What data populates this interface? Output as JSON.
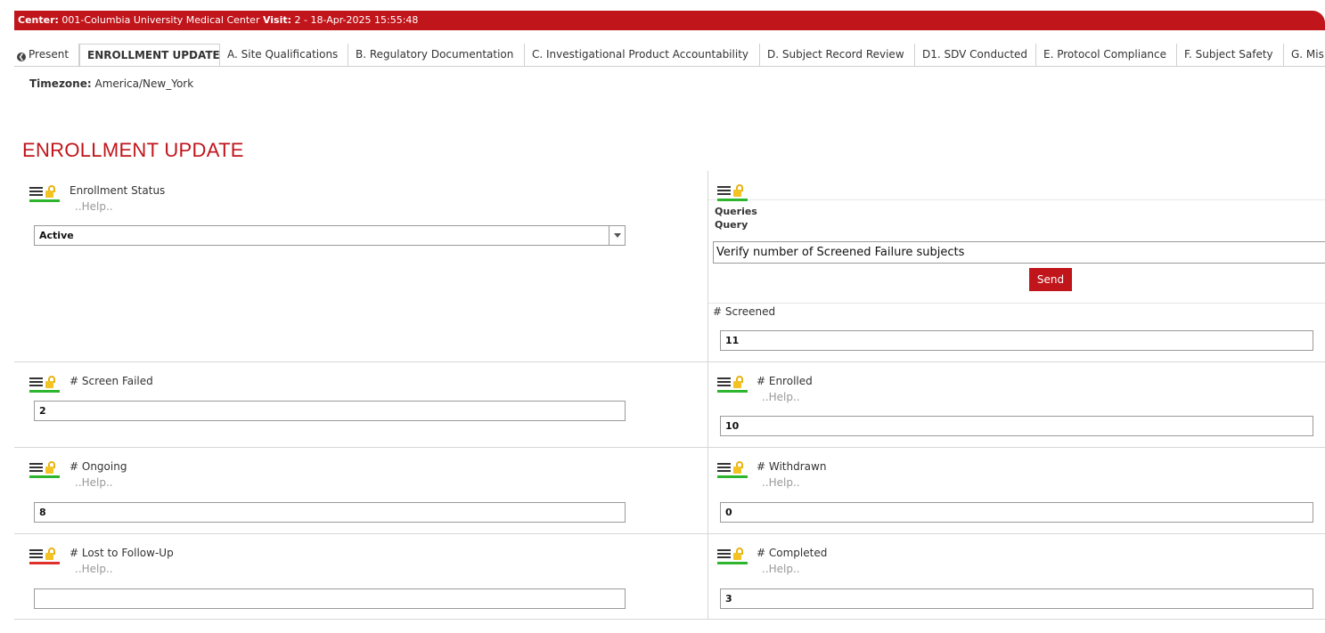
{
  "header": {
    "center_label": "Center:",
    "center_value": "001-Columbia University Medical Center",
    "visit_label": "Visit:",
    "visit_value": "2 - 18-Apr-2025 15:55:48"
  },
  "tabs": [
    {
      "label": "Present",
      "active": false
    },
    {
      "label": "ENROLLMENT UPDATE",
      "active": true
    },
    {
      "label": "A. Site Qualifications",
      "active": false
    },
    {
      "label": "B. Regulatory Documentation",
      "active": false
    },
    {
      "label": "C. Investigational Product Accountability",
      "active": false
    },
    {
      "label": "D. Subject Record Review",
      "active": false
    },
    {
      "label": "D1. SDV Conducted",
      "active": false
    },
    {
      "label": "E. Protocol Compliance",
      "active": false
    },
    {
      "label": "F. Subject Safety",
      "active": false
    },
    {
      "label": "G. Mis",
      "active": false
    }
  ],
  "timezone": {
    "label": "Timezone:",
    "value": "America/New_York"
  },
  "page_title": "ENROLLMENT UPDATE",
  "colors": {
    "brand": "#c0151b",
    "status_ok": "#2db52d",
    "status_missing": "#e0302a",
    "lock": "#f2c322"
  },
  "fields": {
    "enrollment_status": {
      "label": "Enrollment Status",
      "help": "..Help..",
      "value": "Active",
      "status": "ok"
    },
    "screened": {
      "label": "# Screened",
      "value": "11"
    },
    "screen_failed": {
      "label": "# Screen Failed",
      "value": "2",
      "status": "ok"
    },
    "enrolled": {
      "label": "# Enrolled",
      "help": "..Help..",
      "value": "10",
      "status": "ok"
    },
    "ongoing": {
      "label": "# Ongoing",
      "help": "..Help..",
      "value": "8",
      "status": "ok"
    },
    "withdrawn": {
      "label": "# Withdrawn",
      "help": "..Help..",
      "value": "0",
      "status": "ok"
    },
    "lost_to_follow_up": {
      "label": "# Lost to Follow-Up",
      "help": "..Help..",
      "value": "",
      "status": "missing"
    },
    "completed": {
      "label": "# Completed",
      "help": "..Help..",
      "value": "3",
      "status": "ok"
    }
  },
  "queries": {
    "heading": "Queries",
    "subheading": "Query",
    "query_text": "Verify number of Screened Failure subjects",
    "send_label": "Send"
  },
  "icons": {
    "menu": "menu-lines-icon",
    "lock": "unlocked-padlock-icon",
    "back": "circle-back-icon"
  }
}
